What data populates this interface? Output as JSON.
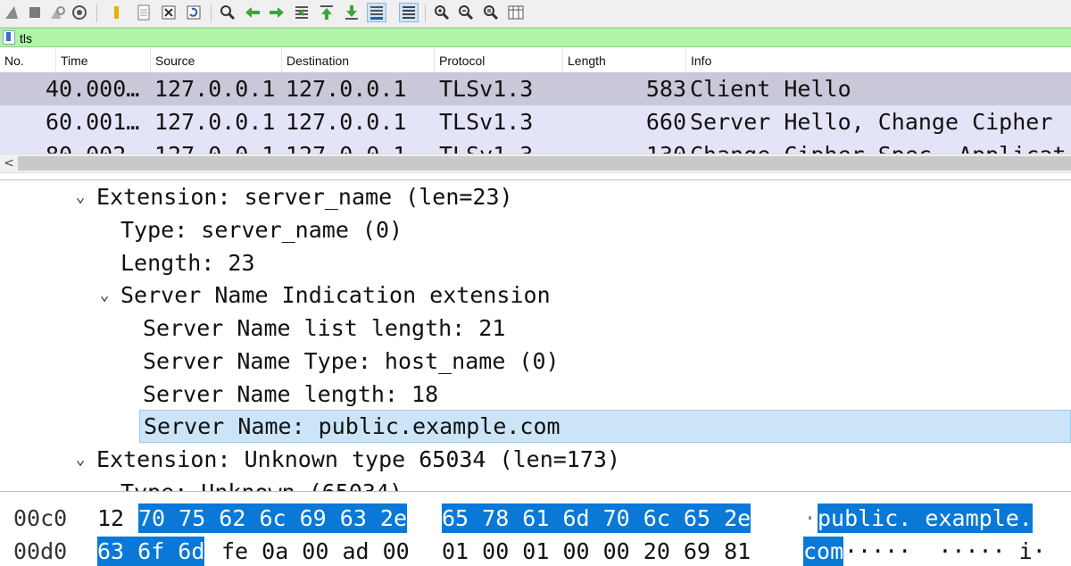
{
  "toolbar": {
    "icons": [
      "shark-start-icon",
      "stop-icon",
      "restart-icon",
      "options-icon",
      "open-icon",
      "file-icon",
      "close-file-icon",
      "reload-icon",
      "find-icon",
      "go-back-icon",
      "go-forward-icon",
      "go-to-packet-icon",
      "first-packet-icon",
      "last-packet-icon",
      "auto-scroll-icon",
      "colorize-icon",
      "zoom-in-icon",
      "zoom-out-icon",
      "normal-size-icon",
      "resize-columns-icon"
    ]
  },
  "filter": {
    "value": "tls"
  },
  "packet_list": {
    "columns": [
      "No.",
      "Time",
      "Source",
      "Destination",
      "Protocol",
      "Length",
      "Info"
    ],
    "rows": [
      {
        "no": "4",
        "time": "0.000…",
        "source": "127.0.0.1",
        "destination": "127.0.0.1",
        "protocol": "TLSv1.3",
        "length": "583",
        "info": "Client Hello",
        "selected": true
      },
      {
        "no": "6",
        "time": "0.001…",
        "source": "127.0.0.1",
        "destination": "127.0.0.1",
        "protocol": "TLSv1.3",
        "length": "660",
        "info": "Server Hello, Change Cipher",
        "selected": false
      },
      {
        "no": "8",
        "time": "0.002…",
        "source": "127.0.0.1",
        "destination": "127.0.0.1",
        "protocol": "TLSv1.3",
        "length": "130",
        "info": "Change Cipher Spec, Applicat",
        "selected": false
      }
    ],
    "scroll_left": "<"
  },
  "details": {
    "lines": [
      {
        "text": "Extension: server_name (len=23)",
        "expander": "⌄"
      },
      {
        "text": "Type: server_name (0)",
        "expander": ""
      },
      {
        "text": "Length: 23",
        "expander": ""
      },
      {
        "text": "Server Name Indication extension",
        "expander": "⌄"
      },
      {
        "text": "Server Name list length: 21",
        "expander": ""
      },
      {
        "text": "Server Name Type: host_name (0)",
        "expander": ""
      },
      {
        "text": "Server Name length: 18",
        "expander": ""
      },
      {
        "text": "Server Name: public.example.com",
        "expander": "",
        "selected": true
      },
      {
        "text": "Extension: Unknown type 65034 (len=173)",
        "expander": "⌄"
      },
      {
        "text": "Type: Unknown (65034)",
        "expander": ""
      }
    ]
  },
  "bytes": {
    "rows": [
      {
        "offset": "00c0",
        "hex_a": "12",
        "hex_b": "70 75 62 6c 69 63 2e",
        "hex_c": "65 78 61 6d 70 6c 65 2e",
        "ascii_a": "·",
        "ascii_b": "public. example."
      },
      {
        "offset": "00d0",
        "hex_a": "63 6f 6d",
        "hex_b": "fe 0a 00 ad 00",
        "hex_c": "01 00 01 00 00 20 69 81",
        "ascii_a": "com",
        "ascii_b": "·····  ····· i·"
      }
    ]
  },
  "colors": {
    "filter_bg": "#b0f4a8",
    "row_selected": "#c8c8d8",
    "row_tls": "#e4e4f8",
    "tree_selected": "#cce4f7",
    "byte_highlight": "#0a78d7"
  }
}
